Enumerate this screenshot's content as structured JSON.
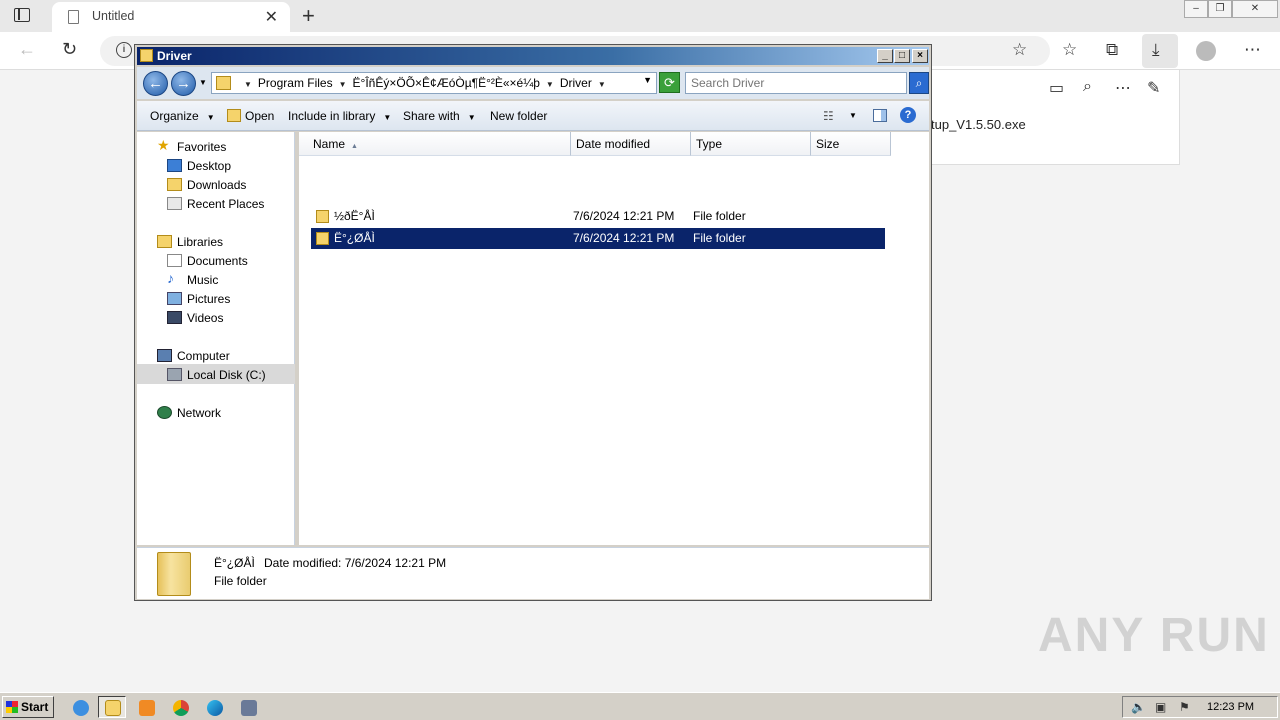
{
  "browser": {
    "tab_title": "Untitled",
    "tab_close": "✕",
    "new_tab": "+",
    "info": "i",
    "download_panel": {
      "filename": "tup_V1.5.50.exe"
    }
  },
  "explorer": {
    "title": "Driver",
    "breadcrumb": [
      "Program Files",
      "Ë°ÎñÊý×ÖÕ×Ê¢ÆóÒµ¶Ë°²È«×é¼þ",
      "Driver"
    ],
    "search_placeholder": "Search Driver",
    "commands": {
      "organize": "Organize",
      "open": "Open",
      "include_in_library": "Include in library",
      "share_with": "Share with",
      "new_folder": "New folder"
    },
    "nav": {
      "favorites": "Favorites",
      "desktop": "Desktop",
      "downloads": "Downloads",
      "recent_places": "Recent Places",
      "libraries": "Libraries",
      "documents": "Documents",
      "music": "Music",
      "pictures": "Pictures",
      "videos": "Videos",
      "computer": "Computer",
      "local_disk": "Local Disk (C:)",
      "network": "Network"
    },
    "columns": {
      "name": "Name",
      "date_modified": "Date modified",
      "type": "Type",
      "size": "Size"
    },
    "files": [
      {
        "name": "½ðË°ÅÌ",
        "date": "7/6/2024 12:21 PM",
        "type": "File folder",
        "selected": false
      },
      {
        "name": "Ë°¿ØÅÌ",
        "date": "7/6/2024 12:21 PM",
        "type": "File folder",
        "selected": true
      }
    ],
    "details": {
      "name": "Ë°¿ØÅÌ",
      "modified_label": "Date modified: 7/6/2024 12:21 PM",
      "type": "File folder"
    }
  },
  "taskbar": {
    "start": "Start",
    "clock": "12:23 PM"
  },
  "watermark": "ANY RUN"
}
